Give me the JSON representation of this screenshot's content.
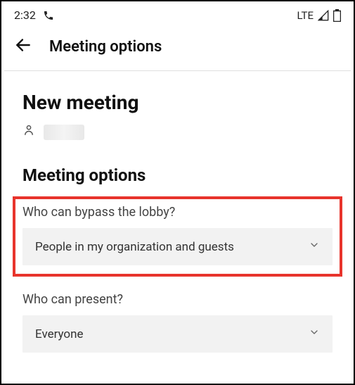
{
  "statusBar": {
    "time": "2:32",
    "network": "LTE"
  },
  "header": {
    "title": "Meeting options"
  },
  "page": {
    "newMeetingTitle": "New meeting",
    "meetingOptionsTitle": "Meeting options"
  },
  "options": {
    "bypassLobby": {
      "label": "Who can bypass the lobby?",
      "selected": "People in my organization and guests"
    },
    "present": {
      "label": "Who can present?",
      "selected": "Everyone"
    }
  }
}
